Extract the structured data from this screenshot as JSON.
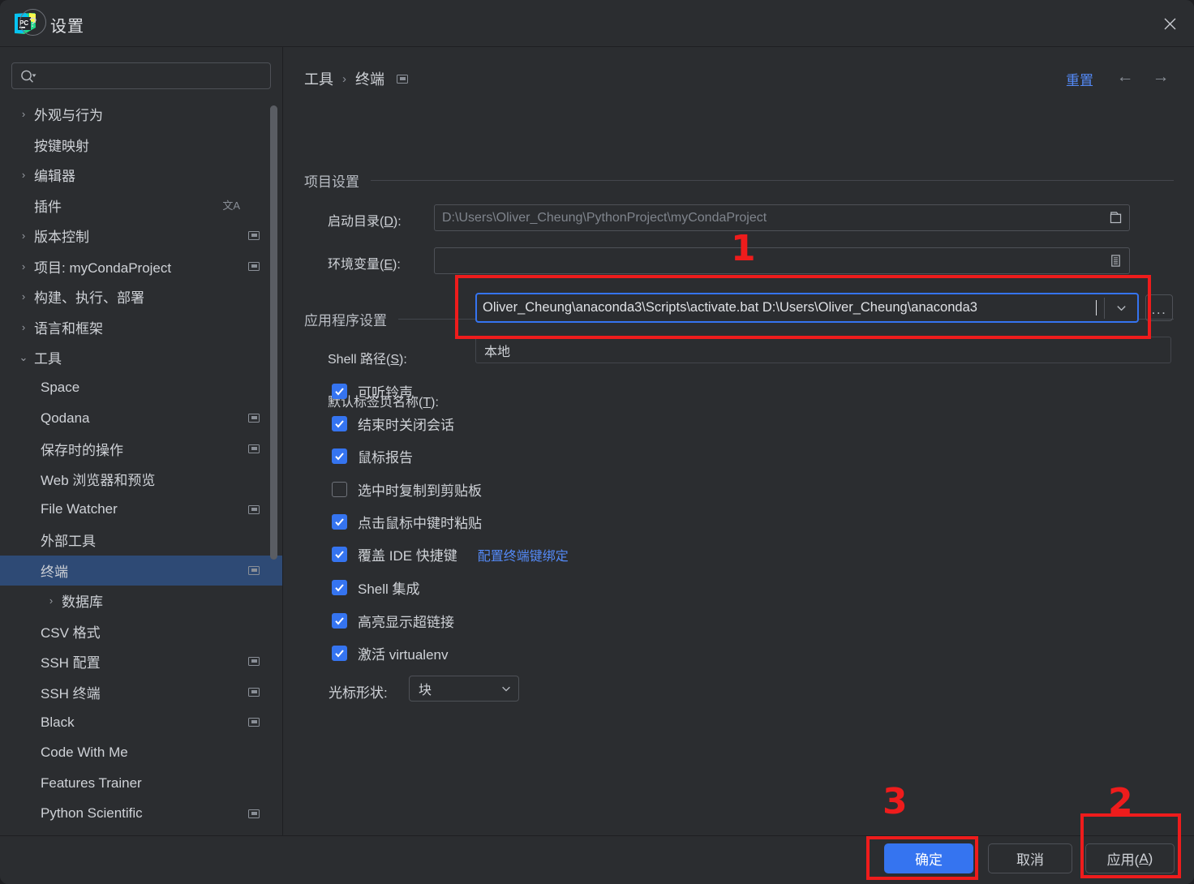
{
  "window": {
    "title": "设置",
    "logo_icon": "pycharm-logo-icon",
    "close_icon": "close-icon"
  },
  "colors": {
    "accent_blue": "#3574f0",
    "link_blue": "#548af7",
    "selection_blue": "#2e4a75",
    "panel_bg": "#2b2d30",
    "border": "#4e5157",
    "annotation_red": "#ee1c1c"
  },
  "sidebar": {
    "search": {
      "value": "",
      "placeholder": "",
      "icon": "search-icon"
    },
    "items": [
      {
        "label": "外观与行为",
        "indent": 0,
        "expandable": true,
        "expanded": false,
        "selected": false,
        "project_badge": false,
        "lang_badge": false
      },
      {
        "label": "按键映射",
        "indent": 0,
        "expandable": false,
        "expanded": false,
        "selected": false,
        "project_badge": false,
        "lang_badge": false
      },
      {
        "label": "编辑器",
        "indent": 0,
        "expandable": true,
        "expanded": false,
        "selected": false,
        "project_badge": false,
        "lang_badge": false
      },
      {
        "label": "插件",
        "indent": 0,
        "expandable": false,
        "expanded": false,
        "selected": false,
        "project_badge": false,
        "lang_badge": true
      },
      {
        "label": "版本控制",
        "indent": 0,
        "expandable": true,
        "expanded": false,
        "selected": false,
        "project_badge": true,
        "lang_badge": false
      },
      {
        "label": "项目: myCondaProject",
        "indent": 0,
        "expandable": true,
        "expanded": false,
        "selected": false,
        "project_badge": true,
        "lang_badge": false
      },
      {
        "label": "构建、执行、部署",
        "indent": 0,
        "expandable": true,
        "expanded": false,
        "selected": false,
        "project_badge": false,
        "lang_badge": false
      },
      {
        "label": "语言和框架",
        "indent": 0,
        "expandable": true,
        "expanded": false,
        "selected": false,
        "project_badge": false,
        "lang_badge": false
      },
      {
        "label": "工具",
        "indent": 0,
        "expandable": true,
        "expanded": true,
        "selected": false,
        "project_badge": false,
        "lang_badge": false
      },
      {
        "label": "Space",
        "indent": 1,
        "expandable": false,
        "expanded": false,
        "selected": false,
        "project_badge": false,
        "lang_badge": false
      },
      {
        "label": "Qodana",
        "indent": 1,
        "expandable": false,
        "expanded": false,
        "selected": false,
        "project_badge": true,
        "lang_badge": false
      },
      {
        "label": "保存时的操作",
        "indent": 1,
        "expandable": false,
        "expanded": false,
        "selected": false,
        "project_badge": true,
        "lang_badge": false
      },
      {
        "label": "Web 浏览器和预览",
        "indent": 1,
        "expandable": false,
        "expanded": false,
        "selected": false,
        "project_badge": false,
        "lang_badge": false
      },
      {
        "label": "File Watcher",
        "indent": 1,
        "expandable": false,
        "expanded": false,
        "selected": false,
        "project_badge": true,
        "lang_badge": false
      },
      {
        "label": "外部工具",
        "indent": 1,
        "expandable": false,
        "expanded": false,
        "selected": false,
        "project_badge": false,
        "lang_badge": false
      },
      {
        "label": "终端",
        "indent": 1,
        "expandable": false,
        "expanded": false,
        "selected": true,
        "project_badge": true,
        "lang_badge": false
      },
      {
        "label": "数据库",
        "indent": 1,
        "expandable": true,
        "expanded": false,
        "selected": false,
        "project_badge": false,
        "lang_badge": false
      },
      {
        "label": "CSV 格式",
        "indent": 1,
        "expandable": false,
        "expanded": false,
        "selected": false,
        "project_badge": false,
        "lang_badge": false
      },
      {
        "label": "SSH 配置",
        "indent": 1,
        "expandable": false,
        "expanded": false,
        "selected": false,
        "project_badge": true,
        "lang_badge": false
      },
      {
        "label": "SSH 终端",
        "indent": 1,
        "expandable": false,
        "expanded": false,
        "selected": false,
        "project_badge": true,
        "lang_badge": false
      },
      {
        "label": "Black",
        "indent": 1,
        "expandable": false,
        "expanded": false,
        "selected": false,
        "project_badge": true,
        "lang_badge": false
      },
      {
        "label": "Code With Me",
        "indent": 1,
        "expandable": false,
        "expanded": false,
        "selected": false,
        "project_badge": false,
        "lang_badge": false
      },
      {
        "label": "Features Trainer",
        "indent": 1,
        "expandable": false,
        "expanded": false,
        "selected": false,
        "project_badge": false,
        "lang_badge": false
      },
      {
        "label": "Python Scientific",
        "indent": 1,
        "expandable": false,
        "expanded": false,
        "selected": false,
        "project_badge": true,
        "lang_badge": false
      }
    ]
  },
  "header": {
    "breadcrumb": [
      "工具",
      "终端"
    ],
    "separator": "›",
    "reset_label": "重置",
    "back_icon": "arrow-left-icon",
    "forward_icon": "arrow-right-icon",
    "scope_badge_icon": "project-scope-icon"
  },
  "project_settings": {
    "group_label": "项目设置",
    "start_dir": {
      "label_prefix": "启动目录(",
      "label_mnemonic": "D",
      "label_suffix": "):",
      "value": "D:\\Users\\Oliver_Cheung\\PythonProject\\myCondaProject",
      "browse_icon": "folder-icon"
    },
    "env_vars": {
      "label_prefix": "环境变量(",
      "label_mnemonic": "E",
      "label_suffix": "):",
      "value": "",
      "browse_icon": "list-edit-icon"
    }
  },
  "app_settings": {
    "group_label": "应用程序设置",
    "shell_path": {
      "label_prefix": "Shell 路径(",
      "label_mnemonic": "S",
      "label_suffix": "):",
      "value_visible": "Oliver_Cheung\\anaconda3\\Scripts\\activate.bat D:\\Users\\Oliver_Cheung\\anaconda3",
      "focused": true,
      "dropdown_icon": "chevron-down-icon",
      "browse_label": "...",
      "clipped_left": true
    },
    "tab_name": {
      "label_prefix": "默认标签页名称(",
      "label_mnemonic": "T",
      "label_suffix": "):",
      "value": "本地"
    },
    "checkboxes": [
      {
        "label": "可听铃声",
        "checked": true,
        "link": ""
      },
      {
        "label": "结束时关闭会话",
        "checked": true,
        "link": ""
      },
      {
        "label": "鼠标报告",
        "checked": true,
        "link": ""
      },
      {
        "label": "选中时复制到剪贴板",
        "checked": false,
        "link": ""
      },
      {
        "label": "点击鼠标中键时粘贴",
        "checked": true,
        "link": ""
      },
      {
        "label": "覆盖 IDE 快捷键",
        "checked": true,
        "link": "配置终端键绑定"
      },
      {
        "label": "Shell 集成",
        "checked": true,
        "link": ""
      },
      {
        "label": "高亮显示超链接",
        "checked": true,
        "link": ""
      },
      {
        "label": "激活 virtualenv",
        "checked": true,
        "link": ""
      }
    ],
    "cursor_shape": {
      "label": "光标形状:",
      "value": "块",
      "chevron_icon": "chevron-down-icon"
    }
  },
  "footer": {
    "help_label": "?",
    "help_icon": "help-icon",
    "ok_label": "确定",
    "cancel_label": "取消",
    "apply_prefix": "应用(",
    "apply_mnemonic": "A",
    "apply_suffix": ")"
  },
  "annotations": [
    {
      "number": "1",
      "target": "shell-path-field"
    },
    {
      "number": "2",
      "target": "apply-button"
    },
    {
      "number": "3",
      "target": "ok-button"
    }
  ]
}
